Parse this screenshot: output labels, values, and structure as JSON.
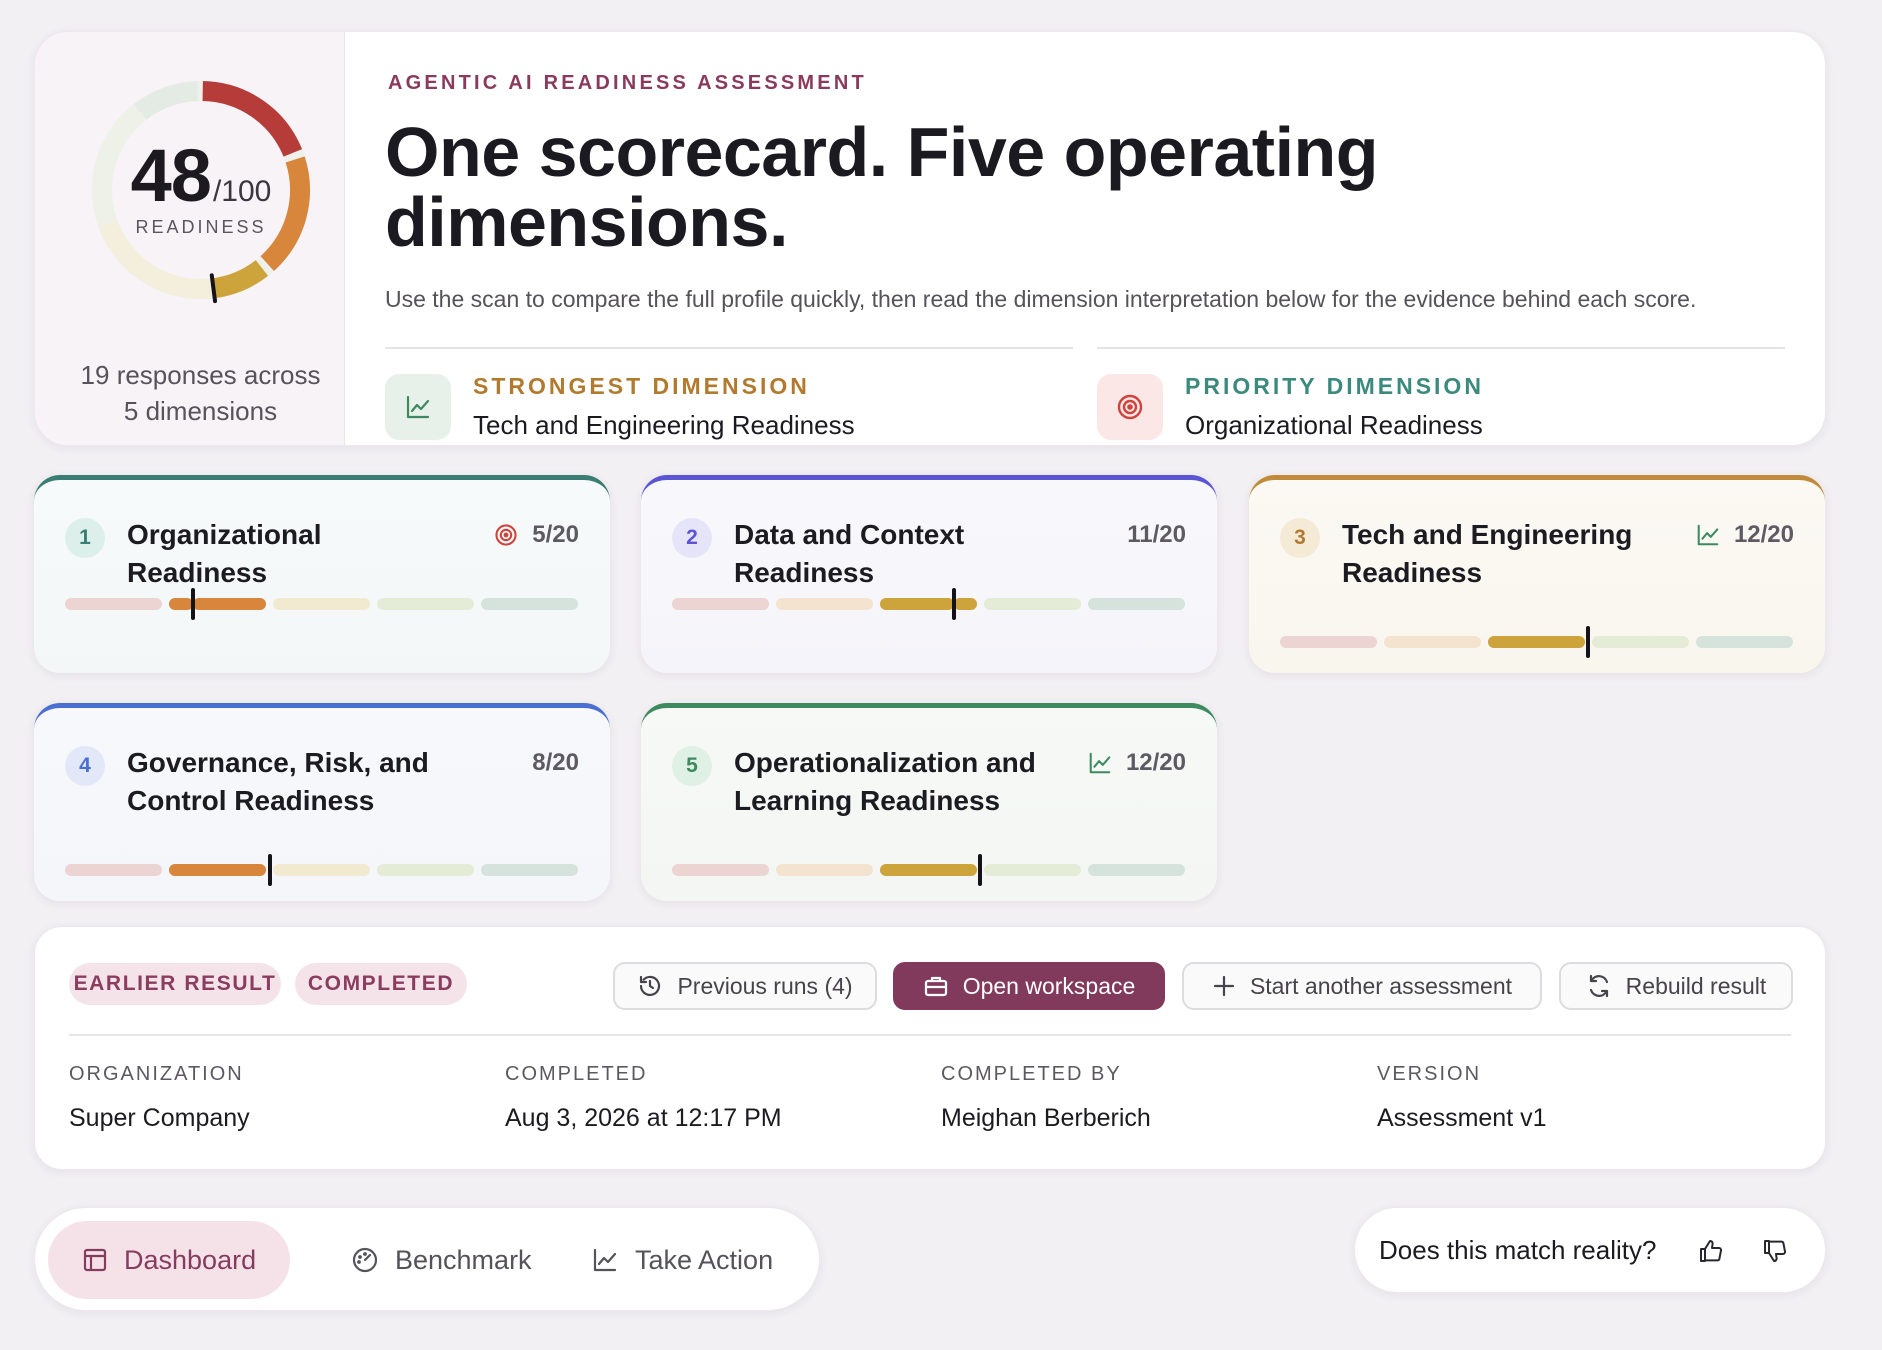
{
  "summary": {
    "score": "48",
    "score_max": "/100",
    "score_label": "READINESS",
    "responses_line1": "19 responses across",
    "responses_line2": "5 dimensions",
    "gauge_value": 48,
    "gauge_colors": [
      "#b63c3a",
      "#d7863b",
      "#cda43c",
      "#e6ecd2",
      "#dde6e0"
    ]
  },
  "header": {
    "eyebrow": "AGENTIC AI READINESS ASSESSMENT",
    "title": "One scorecard. Five operating dimensions.",
    "description": "Use the scan to compare the full profile quickly, then read the dimension interpretation below for the evidence behind each score."
  },
  "highlights": {
    "strongest_label": "STRONGEST DIMENSION",
    "strongest_value": "Tech and Engineering Readiness",
    "priority_label": "PRIORITY DIMENSION",
    "priority_value": "Organizational Readiness"
  },
  "dimensions": [
    {
      "num": "1",
      "title": "Organizational Readiness",
      "score": "5/20",
      "value": 5,
      "icon": "target-icon",
      "accent": "#3a7d72"
    },
    {
      "num": "2",
      "title": "Data and Context Readiness",
      "score": "11/20",
      "value": 11,
      "icon": "",
      "accent": "#5b55d6"
    },
    {
      "num": "3",
      "title": "Tech and Engineering Readiness",
      "score": "12/20",
      "value": 12,
      "icon": "trend-icon",
      "accent": "#c08a3a"
    },
    {
      "num": "4",
      "title": "Governance, Risk, and Control Readiness",
      "score": "8/20",
      "value": 8,
      "icon": "",
      "accent": "#4a6fd2"
    },
    {
      "num": "5",
      "title": "Operationalization and Learning Readiness",
      "score": "12/20",
      "value": 12,
      "icon": "trend-icon",
      "accent": "#3c8a5e"
    }
  ],
  "segment_colors": {
    "base": [
      "#ecd4d3",
      "#f4e4cf",
      "#f2ead0",
      "#e4ecd8",
      "#d6e3dd"
    ],
    "active": [
      "#c0453f",
      "#d7863b",
      "#cda43c",
      "#8cb36e",
      "#5a9a84"
    ]
  },
  "result": {
    "tag1": "EARLIER RESULT",
    "tag2": "COMPLETED",
    "buttons": {
      "previous": "Previous runs (4)",
      "open": "Open workspace",
      "start": "Start another assessment",
      "rebuild": "Rebuild result"
    },
    "meta": [
      {
        "label": "ORGANIZATION",
        "value": "Super Company"
      },
      {
        "label": "COMPLETED",
        "value": "Aug 3, 2026 at 12:17 PM"
      },
      {
        "label": "COMPLETED BY",
        "value": "Meighan Berberich"
      },
      {
        "label": "VERSION",
        "value": "Assessment v1"
      }
    ]
  },
  "nav": {
    "dashboard": "Dashboard",
    "benchmark": "Benchmark",
    "take_action": "Take Action"
  },
  "feedback": {
    "question": "Does this match reality?"
  }
}
